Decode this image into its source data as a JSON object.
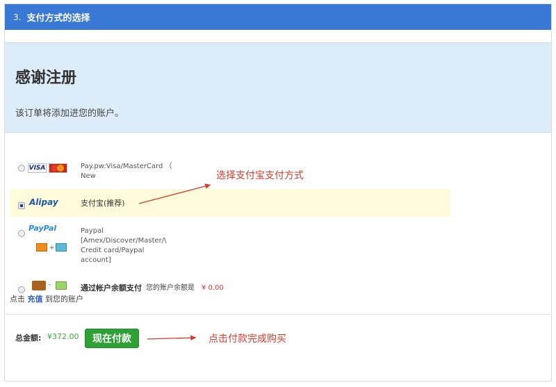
{
  "header": {
    "step_number": "3.",
    "title": "支付方式的选择"
  },
  "thanks": {
    "heading": "感谢注册",
    "message": "该订单将添加进您的账户。"
  },
  "payment_options": [
    {
      "id": "visa",
      "label_line1": "Pay.pw:Visa/MasterCard （",
      "label_line2": "New",
      "logo_visa": "VISA",
      "selected": false
    },
    {
      "id": "alipay",
      "label": "支付宝(推荐)",
      "logo": "Alipay",
      "selected": true
    },
    {
      "id": "paypal",
      "logo": "PayPal",
      "label_lines": [
        "Paypal",
        "[Amex/Discover/Master/\\",
        "Credit card/Paypal",
        "account]"
      ],
      "selected": false
    },
    {
      "id": "balance",
      "label": "通过帐户余额支付",
      "balance_text": "您的账户余额是",
      "balance_value": "¥ 0.00",
      "selected": false
    }
  ],
  "recharge": {
    "prefix": "点击",
    "link": "充值",
    "suffix": "到您的账户"
  },
  "total": {
    "label": "总金额:",
    "value": "¥372.00"
  },
  "paynow_button": "现在付款",
  "annotations": {
    "alipay_note": "选择支付宝支付方式",
    "pay_note": "点击付款完成购买"
  },
  "colors": {
    "header_bg": "#3a78d6",
    "thanks_bg": "#dcecf9",
    "highlight_bg": "#fffbdb",
    "button_bg": "#2ea134",
    "annotation": "#d93a2b"
  }
}
